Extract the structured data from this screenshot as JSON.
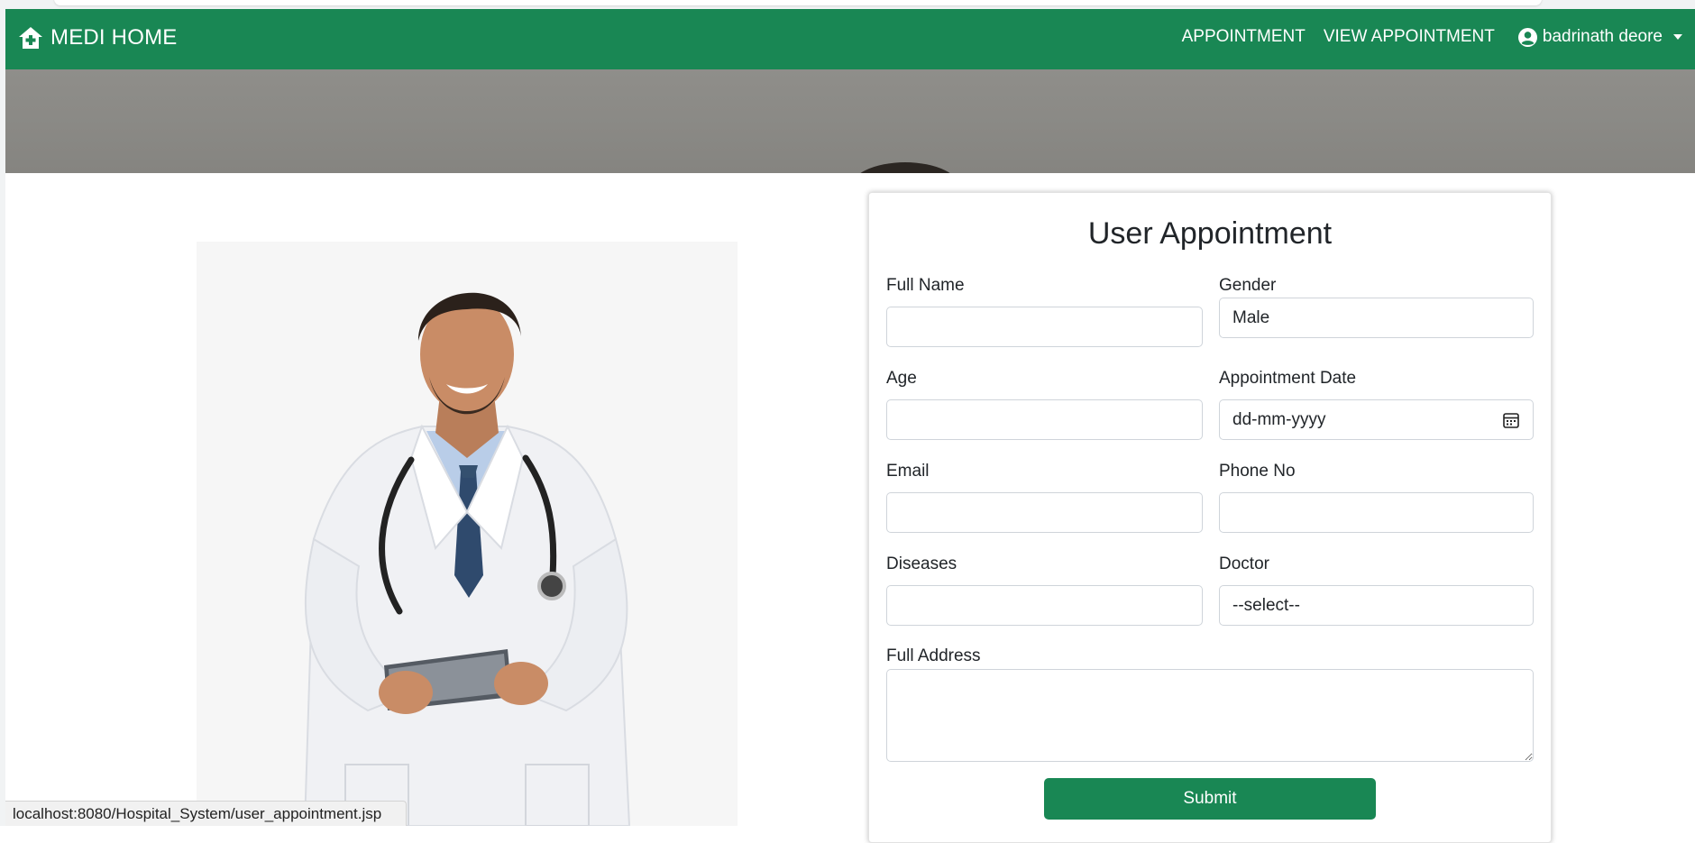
{
  "navbar": {
    "brand": "MEDI HOME",
    "brand_icon": "house-medical-icon",
    "links": [
      "APPOINTMENT",
      "VIEW APPOINTMENT"
    ],
    "user_name": "badrinath deore",
    "user_icon": "user-circle-icon",
    "bg_color": "#198754"
  },
  "form": {
    "title": "User Appointment",
    "full_name": {
      "label": "Full Name",
      "value": ""
    },
    "gender": {
      "label": "Gender",
      "value": "Male"
    },
    "age": {
      "label": "Age",
      "value": ""
    },
    "appointment_date": {
      "label": "Appointment Date",
      "value": "dd-mm-yyyy"
    },
    "email": {
      "label": "Email",
      "value": ""
    },
    "phone": {
      "label": "Phone No",
      "value": ""
    },
    "diseases": {
      "label": "Diseases",
      "value": ""
    },
    "doctor": {
      "label": "Doctor",
      "value": "--select--"
    },
    "address": {
      "label": "Full Address",
      "value": ""
    },
    "submit_label": "Submit"
  },
  "status_bar": {
    "url": "localhost:8080/Hospital_System/user_appointment.jsp"
  }
}
